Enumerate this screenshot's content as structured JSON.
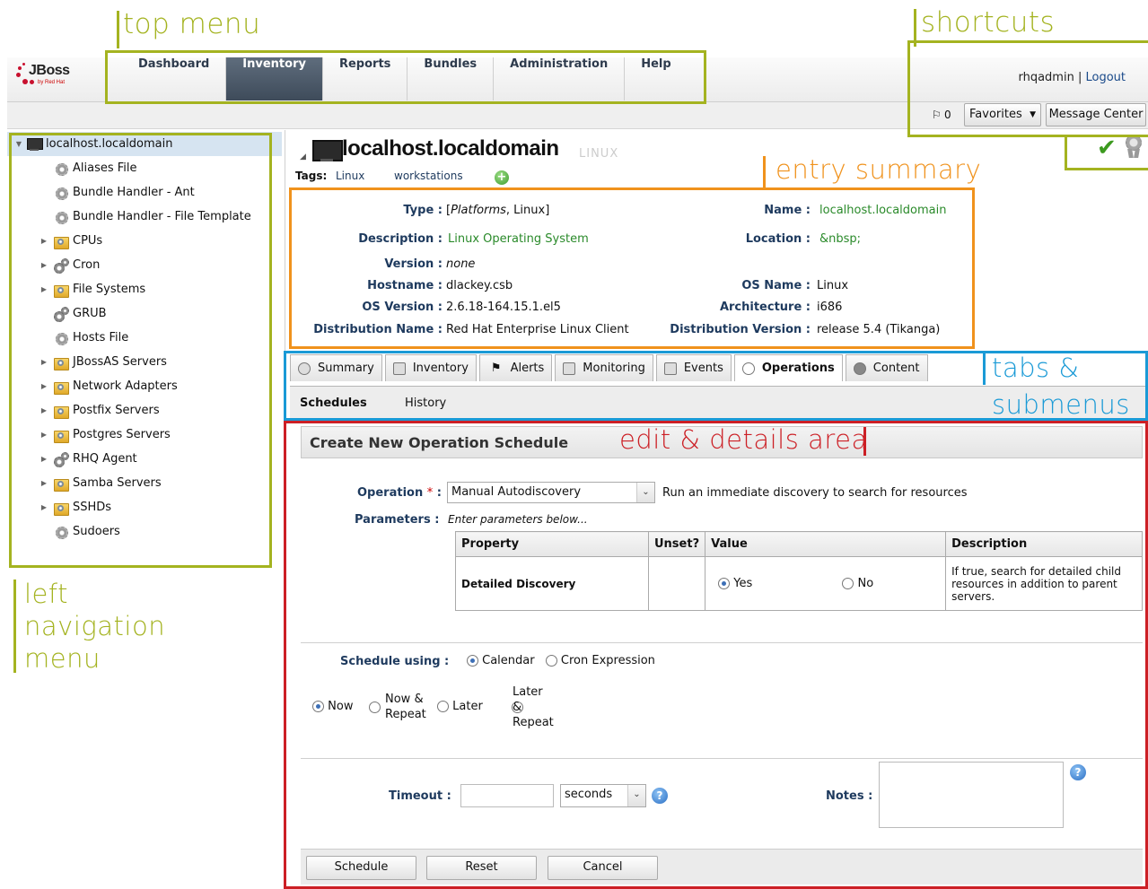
{
  "annotations": {
    "top_menu": "top menu",
    "shortcuts": "shortcuts",
    "entry_summary": "entry summary",
    "tabs_1": "tabs &",
    "tabs_2": "submenus",
    "edit_area": "edit & details area",
    "left_1": "left",
    "left_2": "navigation",
    "left_3": "menu"
  },
  "header": {
    "logo_text": "JBoss",
    "logo_sub": "by Red Hat",
    "nav": [
      "Dashboard",
      "Inventory",
      "Reports",
      "Bundles",
      "Administration",
      "Help"
    ],
    "active_nav": "Inventory",
    "user": "rhqadmin",
    "separator": "|",
    "logout": "Logout"
  },
  "shortcuts": {
    "flag_count": "0",
    "favorites": "Favorites",
    "message_center": "Message Center"
  },
  "tree": {
    "root": "localhost.localdomain",
    "items": [
      {
        "label": "Aliases File",
        "icon": "gear-icon",
        "expandable": false
      },
      {
        "label": "Bundle Handler - Ant",
        "icon": "gear-icon",
        "expandable": false
      },
      {
        "label": "Bundle Handler - File Template",
        "icon": "gear-icon",
        "expandable": false
      },
      {
        "label": "CPUs",
        "icon": "folder-icon",
        "expandable": true
      },
      {
        "label": "Cron",
        "icon": "gears-icon",
        "expandable": true
      },
      {
        "label": "File Systems",
        "icon": "folder-icon",
        "expandable": true
      },
      {
        "label": "GRUB",
        "icon": "gears-icon",
        "expandable": false
      },
      {
        "label": "Hosts File",
        "icon": "gear-icon",
        "expandable": false
      },
      {
        "label": "JBossAS Servers",
        "icon": "folder-icon",
        "expandable": true
      },
      {
        "label": "Network Adapters",
        "icon": "folder-icon",
        "expandable": true
      },
      {
        "label": "Postfix Servers",
        "icon": "folder-icon",
        "expandable": true
      },
      {
        "label": "Postgres Servers",
        "icon": "folder-icon",
        "expandable": true
      },
      {
        "label": "RHQ Agent",
        "icon": "gears-icon",
        "expandable": true
      },
      {
        "label": "Samba Servers",
        "icon": "folder-icon",
        "expandable": true
      },
      {
        "label": "SSHDs",
        "icon": "folder-icon",
        "expandable": true
      },
      {
        "label": "Sudoers",
        "icon": "gear-icon",
        "expandable": false
      }
    ]
  },
  "resource": {
    "name": "localhost.localdomain",
    "badge": "LINUX",
    "tags_label": "Tags:",
    "tags": [
      "Linux",
      "workstations"
    ]
  },
  "summary": {
    "type_label": "Type :",
    "type_value_italic": "Platforms",
    "type_value_rest": ", Linux]",
    "type_value_open": "[",
    "name_label": "Name :",
    "name_value": "localhost.localdomain",
    "description_label": "Description :",
    "description_value": "Linux Operating System",
    "location_label": "Location :",
    "location_value": "&nbsp;",
    "version_label": "Version :",
    "version_value": "none",
    "hostname_label": "Hostname :",
    "hostname_value": "dlackey.csb",
    "osname_label": "OS Name :",
    "osname_value": "Linux",
    "osversion_label": "OS Version :",
    "osversion_value": "2.6.18-164.15.1.el5",
    "arch_label": "Architecture :",
    "arch_value": "i686",
    "distname_label": "Distribution Name :",
    "distname_value": "Red Hat Enterprise Linux Client",
    "distversion_label": "Distribution Version :",
    "distversion_value": "release 5.4 (Tikanga)"
  },
  "tabs": [
    "Summary",
    "Inventory",
    "Alerts",
    "Monitoring",
    "Events",
    "Operations",
    "Content"
  ],
  "active_tab": "Operations",
  "submenu": [
    "Schedules",
    "History"
  ],
  "form": {
    "panel_title": "Create New Operation Schedule",
    "operation_label": "Operation",
    "required_mark": "*",
    "colon": ":",
    "operation_value": "Manual Autodiscovery",
    "operation_desc": "Run an immediate discovery to search for resources",
    "parameters_label": "Parameters :",
    "parameters_hint": "Enter parameters below...",
    "table_headers": [
      "Property",
      "Unset?",
      "Value",
      "Description"
    ],
    "param_property": "Detailed Discovery",
    "param_yes": "Yes",
    "param_no": "No",
    "param_desc": "If true, search for detailed child resources in addition to parent servers.",
    "schedule_label": "Schedule using :",
    "schedule_calendar": "Calendar",
    "schedule_cron": "Cron Expression",
    "when_now": "Now",
    "when_now_repeat_1": "Now &",
    "when_now_repeat_2": "Repeat",
    "when_later": "Later",
    "when_later_repeat_1": "Later",
    "when_later_repeat_2": "&",
    "when_later_repeat_3": "Repeat",
    "timeout_label": "Timeout :",
    "timeout_unit": "seconds",
    "notes_label": "Notes :",
    "buttons": [
      "Schedule",
      "Reset",
      "Cancel"
    ]
  },
  "colors": {
    "olive": "#a4b320",
    "orange": "#f0921c",
    "blue": "#1a9ad6",
    "red": "#cc1f25",
    "nav_active": "#3e4b5a"
  }
}
